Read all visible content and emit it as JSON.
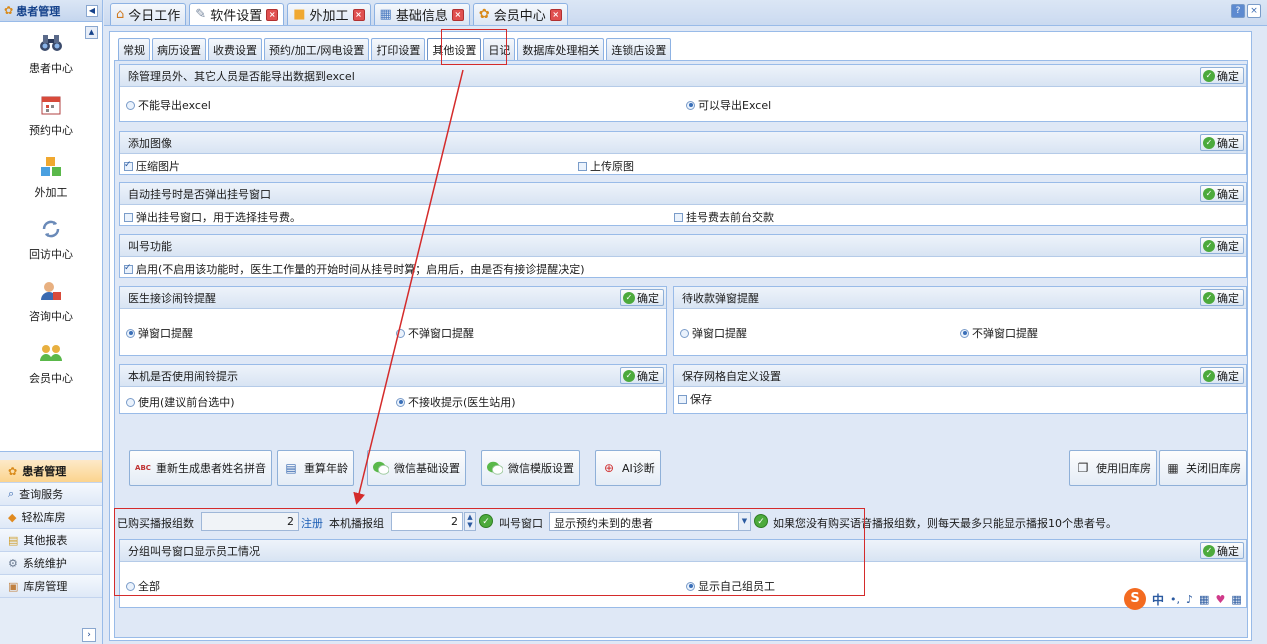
{
  "sidebar": {
    "header": "患者管理",
    "items": [
      {
        "label": "患者中心",
        "icon": "binoculars-icon"
      },
      {
        "label": "预约中心",
        "icon": "calendar-icon"
      },
      {
        "label": "外加工",
        "icon": "cubes-icon"
      },
      {
        "label": "回访中心",
        "icon": "refresh-icon"
      },
      {
        "label": "咨询中心",
        "icon": "consult-icon"
      },
      {
        "label": "会员中心",
        "icon": "members-icon"
      }
    ],
    "bottom": [
      "患者管理",
      "查询服务",
      "轻松库房",
      "其他报表",
      "系统维护",
      "库房管理"
    ]
  },
  "top_tabs": [
    "今日工作",
    "软件设置",
    "外加工",
    "基础信息",
    "会员中心"
  ],
  "sub_tabs": [
    "常规",
    "病历设置",
    "收费设置",
    "预约/加工/网电设置",
    "打印设置",
    "其他设置",
    "日记",
    "数据库处理相关",
    "连锁店设置"
  ],
  "ok_label": "确定",
  "panels": {
    "export": {
      "title": "除管理员外、其它人员是否能导出数据到excel",
      "opt1": "不能导出excel",
      "opt2": "可以导出Excel"
    },
    "image": {
      "title": "添加图像",
      "opt1": "压缩图片",
      "opt2": "上传原图"
    },
    "register": {
      "title": "自动挂号时是否弹出挂号窗口",
      "opt1": "弹出挂号窗口，用于选择挂号费。",
      "opt2": "挂号费去前台交款"
    },
    "call": {
      "title": "叫号功能",
      "opt1": "启用(不启用该功能时，医生工作量的开始时间从挂号时算；启用后，由是否有接诊提醒决定)"
    },
    "doctor_bell": {
      "title": "医生接诊闹铃提醒",
      "opt1": "弹窗口提醒",
      "opt2": "不弹窗口提醒"
    },
    "pay_popup": {
      "title": "待收款弹窗提醒",
      "opt1": "弹窗口提醒",
      "opt2": "不弹窗口提醒"
    },
    "local_bell": {
      "title": "本机是否使用闹铃提示",
      "opt1": "使用(建议前台选中)",
      "opt2": "不接收提示(医生站用)"
    },
    "grid_save": {
      "title": "保存网格自定义设置",
      "opt1": "保存"
    },
    "group_call": {
      "title": "分组叫号窗口显示员工情况",
      "opt1": "全部",
      "opt2": "显示自己组员工"
    }
  },
  "tools": {
    "regen": "重新生成患者姓名拼音",
    "age": "重算年龄",
    "wx_basic": "微信基础设置",
    "wx_tpl": "微信模版设置",
    "ai": "AI诊断",
    "old_use": "使用旧库房",
    "old_close": "关闭旧库房",
    "abc": "ABC"
  },
  "form": {
    "bought_label": "已购买播报组数",
    "bought_value": "2",
    "register_link": "注册",
    "local_group_label": "本机播报组",
    "local_group_value": "2",
    "call_window_label": "叫号窗口",
    "call_window_value": "显示预约未到的患者",
    "note": "如果您没有购买语音播报组数，则每天最多只能显示播报10个患者号。"
  },
  "ime": {
    "logo": "S",
    "lang": "中"
  }
}
